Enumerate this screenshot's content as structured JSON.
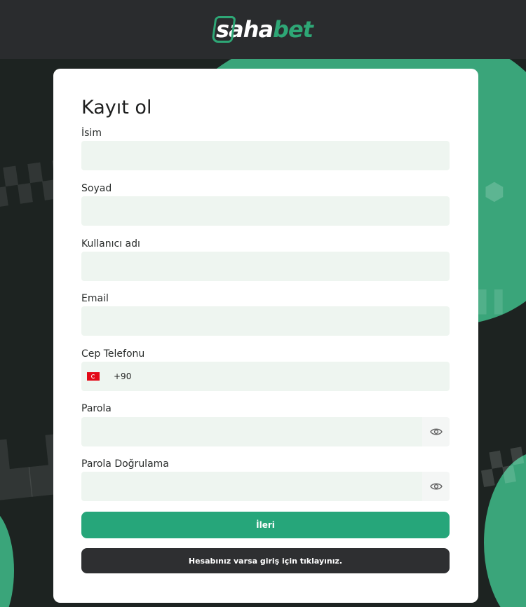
{
  "brand": {
    "name_part1": "saha",
    "name_part2": "bet",
    "accent": "#2ea776"
  },
  "form": {
    "title": "Kayıt ol",
    "fields": {
      "first_name": {
        "label": "İsim",
        "value": ""
      },
      "last_name": {
        "label": "Soyad",
        "value": ""
      },
      "username": {
        "label": "Kullanıcı adı",
        "value": ""
      },
      "email": {
        "label": "Email",
        "value": ""
      },
      "phone": {
        "label": "Cep Telefonu",
        "dial_code": "+90",
        "country_flag": "turkey-flag-icon",
        "value": ""
      },
      "password": {
        "label": "Parola",
        "value": "",
        "toggle_icon": "eye-icon"
      },
      "password_confirm": {
        "label": "Parola Doğrulama",
        "value": "",
        "toggle_icon": "eye-icon"
      }
    },
    "next_button": "İleri",
    "login_link": "Hesabınız varsa giriş için tıklayınız.",
    "colors": {
      "primary_button": "#26a67a",
      "secondary_button": "#2e2f31",
      "input_bg": "#eef5f0"
    }
  }
}
